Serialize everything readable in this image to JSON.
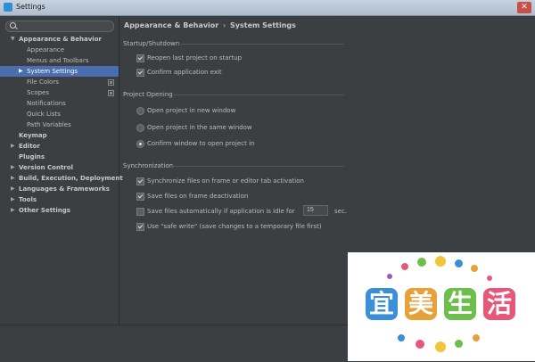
{
  "window": {
    "title": "Settings",
    "close_glyph": "✕"
  },
  "search": {
    "placeholder": ""
  },
  "tree": [
    {
      "label": "Appearance & Behavior",
      "level": 0,
      "expanded": true,
      "bold": true
    },
    {
      "label": "Appearance",
      "level": 1
    },
    {
      "label": "Menus and Toolbars",
      "level": 1
    },
    {
      "label": "System Settings",
      "level": 1,
      "expandable": true,
      "selected": true
    },
    {
      "label": "File Colors",
      "level": 1,
      "project_icon": true
    },
    {
      "label": "Scopes",
      "level": 1,
      "project_icon": true
    },
    {
      "label": "Notifications",
      "level": 1
    },
    {
      "label": "Quick Lists",
      "level": 1
    },
    {
      "label": "Path Variables",
      "level": 1
    },
    {
      "label": "Keymap",
      "level": 0,
      "bold": true
    },
    {
      "label": "Editor",
      "level": 0,
      "expandable": true,
      "bold": true
    },
    {
      "label": "Plugins",
      "level": 0,
      "bold": true
    },
    {
      "label": "Version Control",
      "level": 0,
      "expandable": true,
      "bold": true
    },
    {
      "label": "Build, Execution, Deployment",
      "level": 0,
      "expandable": true,
      "bold": true
    },
    {
      "label": "Languages & Frameworks",
      "level": 0,
      "expandable": true,
      "bold": true
    },
    {
      "label": "Tools",
      "level": 0,
      "expandable": true,
      "bold": true
    },
    {
      "label": "Other Settings",
      "level": 0,
      "expandable": true,
      "bold": true
    }
  ],
  "breadcrumb": {
    "parent": "Appearance & Behavior",
    "separator": "›",
    "current": "System Settings"
  },
  "startup": {
    "title": "Startup/Shutdown",
    "reopen": {
      "label": "Reopen last project on startup",
      "checked": true
    },
    "confirm_exit": {
      "label": "Confirm application exit",
      "checked": true
    }
  },
  "project_opening": {
    "title": "Project Opening",
    "options": [
      {
        "label": "Open project in new window",
        "checked": false
      },
      {
        "label": "Open project in the same window",
        "checked": false
      },
      {
        "label": "Confirm window to open project in",
        "checked": true
      }
    ]
  },
  "sync": {
    "title": "Synchronization",
    "frame_activation": {
      "label": "Synchronize files on frame or editor tab activation",
      "checked": true
    },
    "frame_deactivation": {
      "label": "Save files on frame deactivation",
      "checked": true
    },
    "auto_save": {
      "label": "Save files automatically if application is idle for",
      "checked": false,
      "value": "15",
      "unit": "sec."
    },
    "safe_write": {
      "label": "Use \"safe write\" (save changes to a temporary file first)",
      "checked": true
    }
  },
  "watermark": {
    "text": [
      "宜",
      "美",
      "生",
      "活"
    ],
    "colors": [
      "#3b8fd6",
      "#e8a03a",
      "#6cbf4a",
      "#e6577a"
    ]
  },
  "colors": {
    "selection": "#4b6eaf",
    "background": "#3c3f41"
  }
}
